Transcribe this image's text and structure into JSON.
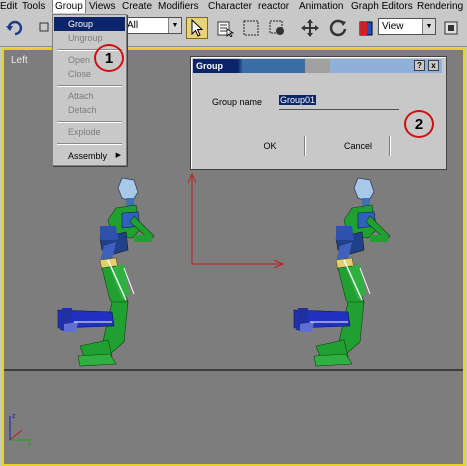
{
  "menubar": {
    "items": [
      "Edit",
      "Tools",
      "Group",
      "Views",
      "Create",
      "Modifiers",
      "Character",
      "reactor",
      "Animation",
      "Graph Editors",
      "Rendering"
    ]
  },
  "toolbar": {
    "selection_filter": "All",
    "view_select": "View"
  },
  "viewport": {
    "label": "Left"
  },
  "group_menu": {
    "items": [
      {
        "label": "Group",
        "enabled": true,
        "highlighted": true
      },
      {
        "label": "Ungroup",
        "enabled": false
      },
      {
        "label": "Open",
        "enabled": false
      },
      {
        "label": "Close",
        "enabled": false
      },
      {
        "label": "Attach",
        "enabled": false
      },
      {
        "label": "Detach",
        "enabled": false
      },
      {
        "label": "Explode",
        "enabled": false
      },
      {
        "label": "Assembly",
        "enabled": true,
        "submenu": true
      }
    ]
  },
  "dialog": {
    "title": "Group",
    "help_btn": "?",
    "close_btn": "x",
    "field_label": "Group name",
    "field_value": "Group01",
    "ok_label": "OK",
    "cancel_label": "Cancel"
  },
  "annotations": {
    "one": "1",
    "two": "2"
  },
  "colors": {
    "viewport_bg": "#7d7d7d",
    "viewport_border": "#e8d22a",
    "highlight": "#0b246a",
    "annotation": "#d01010"
  },
  "icons": [
    "undo-icon",
    "select-object-icon",
    "select-by-name-icon",
    "rectangular-selection-icon",
    "window-crossing-icon",
    "select-and-move-icon",
    "select-and-rotate-icon",
    "select-and-scale-icon"
  ]
}
